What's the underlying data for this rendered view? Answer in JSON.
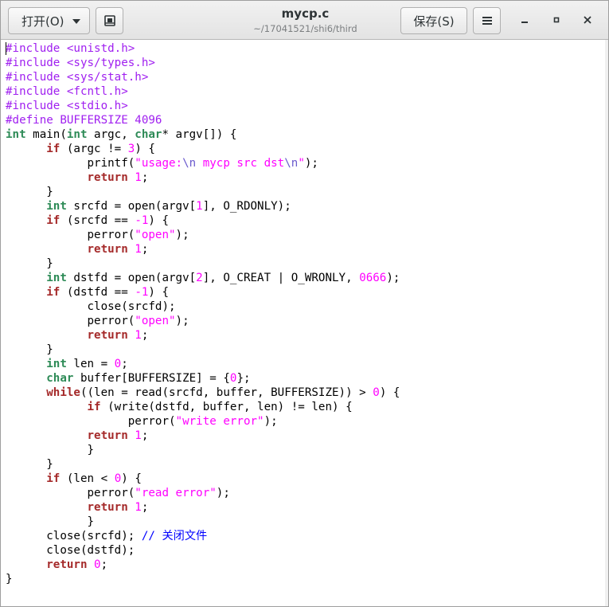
{
  "header": {
    "title": "mycp.c",
    "subtitle": "~/17041521/shi6/third",
    "open_label": "打开(O)",
    "save_label": "保存(S)"
  },
  "icons": {
    "open_dropdown": "chevron-down-icon",
    "new_document": "new-document-icon",
    "menu": "hamburger-menu-icon",
    "minimize": "minimize-icon",
    "maximize": "maximize-icon",
    "close": "close-icon"
  },
  "colors": {
    "preprocessor": "#a020f0",
    "keyword": "#a52a2a",
    "type": "#2e8b57",
    "string": "#ff00ff",
    "comment": "#0000ff"
  },
  "code": {
    "lines": [
      [
        [
          "pp",
          "#include <unistd.h>"
        ]
      ],
      [
        [
          "pp",
          "#include <sys/types.h>"
        ]
      ],
      [
        [
          "pp",
          "#include <sys/stat.h>"
        ]
      ],
      [
        [
          "pp",
          "#include <fcntl.h>"
        ]
      ],
      [
        [
          "pp",
          "#include <stdio.h>"
        ]
      ],
      [
        [
          "pp",
          "#define BUFFERSIZE 4096"
        ]
      ],
      [
        [
          "ty",
          "int"
        ],
        [
          "",
          " main("
        ],
        [
          "ty",
          "int"
        ],
        [
          "",
          " argc, "
        ],
        [
          "ty",
          "char"
        ],
        [
          "",
          "* argv[]) {"
        ]
      ],
      [
        [
          "",
          "      "
        ],
        [
          "kw",
          "if"
        ],
        [
          "",
          " (argc != "
        ],
        [
          "num",
          "3"
        ],
        [
          "",
          ") {"
        ]
      ],
      [
        [
          "",
          "            printf("
        ],
        [
          "str",
          "\"usage:"
        ],
        [
          "esc",
          "\\n"
        ],
        [
          "str",
          " mycp src dst"
        ],
        [
          "esc",
          "\\n"
        ],
        [
          "str",
          "\""
        ],
        [
          "",
          ");"
        ]
      ],
      [
        [
          "",
          "            "
        ],
        [
          "kw",
          "return"
        ],
        [
          "",
          " "
        ],
        [
          "num",
          "1"
        ],
        [
          "",
          ";"
        ]
      ],
      [
        [
          "",
          "      }"
        ]
      ],
      [
        [
          "",
          "      "
        ],
        [
          "ty",
          "int"
        ],
        [
          "",
          " srcfd = open(argv["
        ],
        [
          "num",
          "1"
        ],
        [
          "",
          "], O_RDONLY);"
        ]
      ],
      [
        [
          "",
          "      "
        ],
        [
          "kw",
          "if"
        ],
        [
          "",
          " (srcfd == "
        ],
        [
          "num",
          "-1"
        ],
        [
          "",
          ") {"
        ]
      ],
      [
        [
          "",
          "            perror("
        ],
        [
          "str",
          "\"open\""
        ],
        [
          "",
          ");"
        ]
      ],
      [
        [
          "",
          "            "
        ],
        [
          "kw",
          "return"
        ],
        [
          "",
          " "
        ],
        [
          "num",
          "1"
        ],
        [
          "",
          ";"
        ]
      ],
      [
        [
          "",
          "      }"
        ]
      ],
      [
        [
          "",
          "      "
        ],
        [
          "ty",
          "int"
        ],
        [
          "",
          " dstfd = open(argv["
        ],
        [
          "num",
          "2"
        ],
        [
          "",
          "], O_CREAT | O_WRONLY, "
        ],
        [
          "num",
          "0666"
        ],
        [
          "",
          ");"
        ]
      ],
      [
        [
          "",
          "      "
        ],
        [
          "kw",
          "if"
        ],
        [
          "",
          " (dstfd == "
        ],
        [
          "num",
          "-1"
        ],
        [
          "",
          ") {"
        ]
      ],
      [
        [
          "",
          "            close(srcfd);"
        ]
      ],
      [
        [
          "",
          "            perror("
        ],
        [
          "str",
          "\"open\""
        ],
        [
          "",
          ");"
        ]
      ],
      [
        [
          "",
          "            "
        ],
        [
          "kw",
          "return"
        ],
        [
          "",
          " "
        ],
        [
          "num",
          "1"
        ],
        [
          "",
          ";"
        ]
      ],
      [
        [
          "",
          "      }"
        ]
      ],
      [
        [
          "",
          "      "
        ],
        [
          "ty",
          "int"
        ],
        [
          "",
          " len = "
        ],
        [
          "num",
          "0"
        ],
        [
          "",
          ";"
        ]
      ],
      [
        [
          "",
          "      "
        ],
        [
          "ty",
          "char"
        ],
        [
          "",
          " buffer[BUFFERSIZE] = {"
        ],
        [
          "num",
          "0"
        ],
        [
          "",
          "};"
        ]
      ],
      [
        [
          "",
          "      "
        ],
        [
          "kw",
          "while"
        ],
        [
          "",
          "((len = read(srcfd, buffer, BUFFERSIZE)) > "
        ],
        [
          "num",
          "0"
        ],
        [
          "",
          ") {"
        ]
      ],
      [
        [
          "",
          "            "
        ],
        [
          "kw",
          "if"
        ],
        [
          "",
          " (write(dstfd, buffer, len) != len) {"
        ]
      ],
      [
        [
          "",
          "                  perror("
        ],
        [
          "str",
          "\"write error\""
        ],
        [
          "",
          ");"
        ]
      ],
      [
        [
          "",
          "            "
        ],
        [
          "kw",
          "return"
        ],
        [
          "",
          " "
        ],
        [
          "num",
          "1"
        ],
        [
          "",
          ";"
        ]
      ],
      [
        [
          "",
          "            }"
        ]
      ],
      [
        [
          "",
          "      }"
        ]
      ],
      [
        [
          "",
          "      "
        ],
        [
          "kw",
          "if"
        ],
        [
          "",
          " (len < "
        ],
        [
          "num",
          "0"
        ],
        [
          "",
          ") {"
        ]
      ],
      [
        [
          "",
          "            perror("
        ],
        [
          "str",
          "\"read error\""
        ],
        [
          "",
          ");"
        ]
      ],
      [
        [
          "",
          "            "
        ],
        [
          "kw",
          "return"
        ],
        [
          "",
          " "
        ],
        [
          "num",
          "1"
        ],
        [
          "",
          ";"
        ]
      ],
      [
        [
          "",
          "            }"
        ]
      ],
      [
        [
          "",
          "      close(srcfd); "
        ],
        [
          "cm",
          "// 关闭文件"
        ]
      ],
      [
        [
          "",
          "      close(dstfd);"
        ]
      ],
      [
        [
          "",
          "      "
        ],
        [
          "kw",
          "return"
        ],
        [
          "",
          " "
        ],
        [
          "num",
          "0"
        ],
        [
          "",
          ";"
        ]
      ],
      [
        [
          "",
          "}"
        ]
      ]
    ]
  }
}
